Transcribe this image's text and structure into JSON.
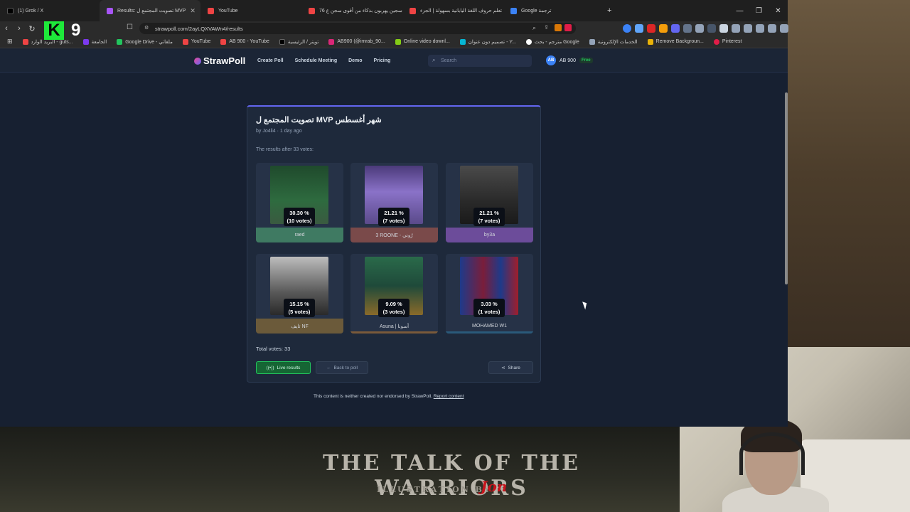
{
  "tabs": [
    {
      "title": "(1) Grok / X",
      "color": "#000000"
    },
    {
      "title": "Results: تصويت المجتمع ل MVP",
      "color": "#a855f7",
      "active": true
    },
    {
      "title": "YouTube",
      "color": "#ef4444"
    },
    {
      "title": "76 سجين يهربون بذكاء من أقوى سجن ع...",
      "color": "#ef4444"
    },
    {
      "title": "تعلم حروف اللغة اليابانية بسهولة | الجزء",
      "color": "#ef4444"
    },
    {
      "title": "Google ترجمة",
      "color": "#3b82f6"
    }
  ],
  "overlay": {
    "k": "K",
    "nine": "9"
  },
  "url": "strawpoll.com/2ayLQXVAWn4/results",
  "bookmarks": [
    "البريد الوارد - guts...",
    "الجامعة",
    "Google Drive - ملفاتي",
    "YouTube",
    "AB 900 - YouTube",
    "تويتر / الرئيسية",
    "AB900 (@imrab_90...",
    "Online video downl...",
    "تصميم دون عنوان - Y...",
    "مترجم - بحث Google",
    "الخدمات الإلكترونية",
    "Remove Backgroun...",
    "Pinterest"
  ],
  "site": {
    "logo": "StrawPoll",
    "nav": [
      "Create Poll",
      "Schedule Meeting",
      "Demo",
      "Pricing"
    ],
    "search_placeholder": "Search",
    "user_initials": "AB",
    "user_name": "AB 900",
    "plan": "Free"
  },
  "poll": {
    "title": "شهر أغسطس MVP تصويت المجتمع ل",
    "meta": "by Jo4li4 · 1 day ago",
    "results_after": "The results after 33 votes:",
    "options": [
      {
        "label": "raed",
        "percent": "30.30 %",
        "votes": "(10 votes)",
        "color": "#3f7a62",
        "img": "#2e6b3f"
      },
      {
        "label": "3 ROONE - رُوني",
        "percent": "21.21 %",
        "votes": "(7 votes)",
        "color": "#7a4a4a",
        "img": "#6b5aa8"
      },
      {
        "label": "by3a",
        "percent": "21.21 %",
        "votes": "(7 votes)",
        "color": "#6c4c9a",
        "img": "#3a3a3a"
      },
      {
        "label": "تايف NF",
        "percent": "15.15 %",
        "votes": "(5 votes)",
        "color": "#6b5a3a",
        "img": "#8a8a8a"
      },
      {
        "label": "Asuna | أسونا",
        "percent": "9.09 %",
        "votes": "(3 votes)",
        "color": "#7a5a3a",
        "img": "#1f4a3a"
      },
      {
        "label": "MOHAMED W1",
        "percent": "3.03 %",
        "votes": "(1 votes)",
        "color": "#2a5a7a",
        "img": "#7a1e3a"
      }
    ],
    "total_votes": "Total votes: 33",
    "buttons": {
      "live": "Live results",
      "back": "Back to poll",
      "share": "Share"
    }
  },
  "footer": {
    "note": "This content is neither created nor endorsed by StrawPoll.",
    "report": "Report content"
  },
  "banner": {
    "title": "THE TALK OF THE WARRIORS",
    "sub": "ILLUSTRATION BY",
    "sig": "Jon"
  }
}
